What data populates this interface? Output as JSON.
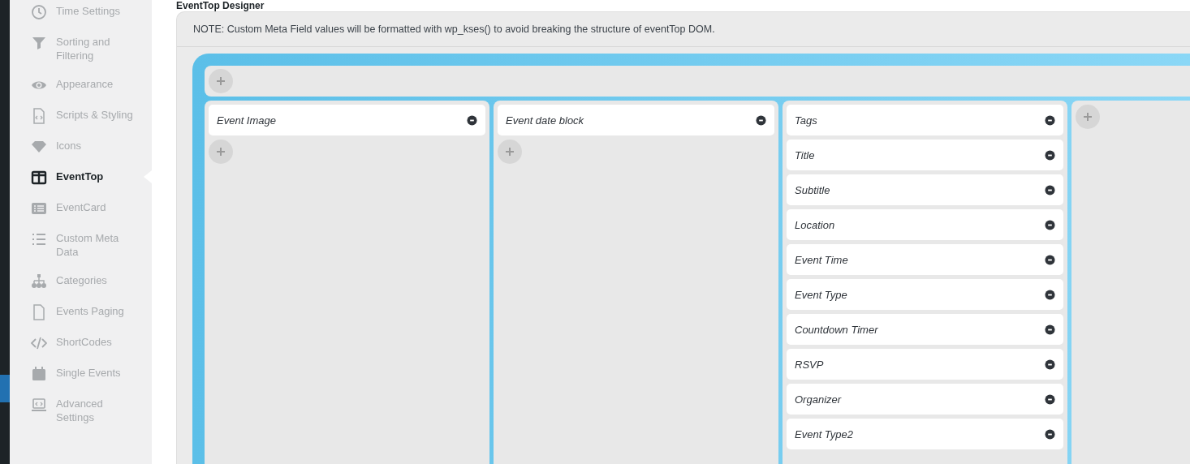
{
  "sidebar": {
    "items": [
      {
        "label": "Time Settings",
        "selected": false
      },
      {
        "label": "Sorting and Filtering",
        "selected": false
      },
      {
        "label": "Appearance",
        "selected": false
      },
      {
        "label": "Scripts & Styling",
        "selected": false
      },
      {
        "label": "Icons",
        "selected": false
      },
      {
        "label": "EventTop",
        "selected": true
      },
      {
        "label": "EventCard",
        "selected": false
      },
      {
        "label": "Custom Meta Data",
        "selected": false
      },
      {
        "label": "Categories",
        "selected": false
      },
      {
        "label": "Events Paging",
        "selected": false
      },
      {
        "label": "ShortCodes",
        "selected": false
      },
      {
        "label": "Single Events",
        "selected": false
      },
      {
        "label": "Advanced Settings",
        "selected": false
      }
    ]
  },
  "designer": {
    "title": "EventTop Designer",
    "note": "NOTE: Custom Meta Field values will be formatted with wp_kses() to avoid breaking the structure of eventTop DOM.",
    "columns": [
      {
        "fields": [
          {
            "label": "Event Image"
          }
        ]
      },
      {
        "fields": [
          {
            "label": "Event date block"
          }
        ]
      },
      {
        "fields": [
          {
            "label": "Tags"
          },
          {
            "label": "Title"
          },
          {
            "label": "Subtitle"
          },
          {
            "label": "Location"
          },
          {
            "label": "Event Time"
          },
          {
            "label": "Event Type"
          },
          {
            "label": "Countdown Timer"
          },
          {
            "label": "RSVP"
          },
          {
            "label": "Organizer"
          },
          {
            "label": "Event Type2"
          }
        ]
      },
      {}
    ]
  }
}
